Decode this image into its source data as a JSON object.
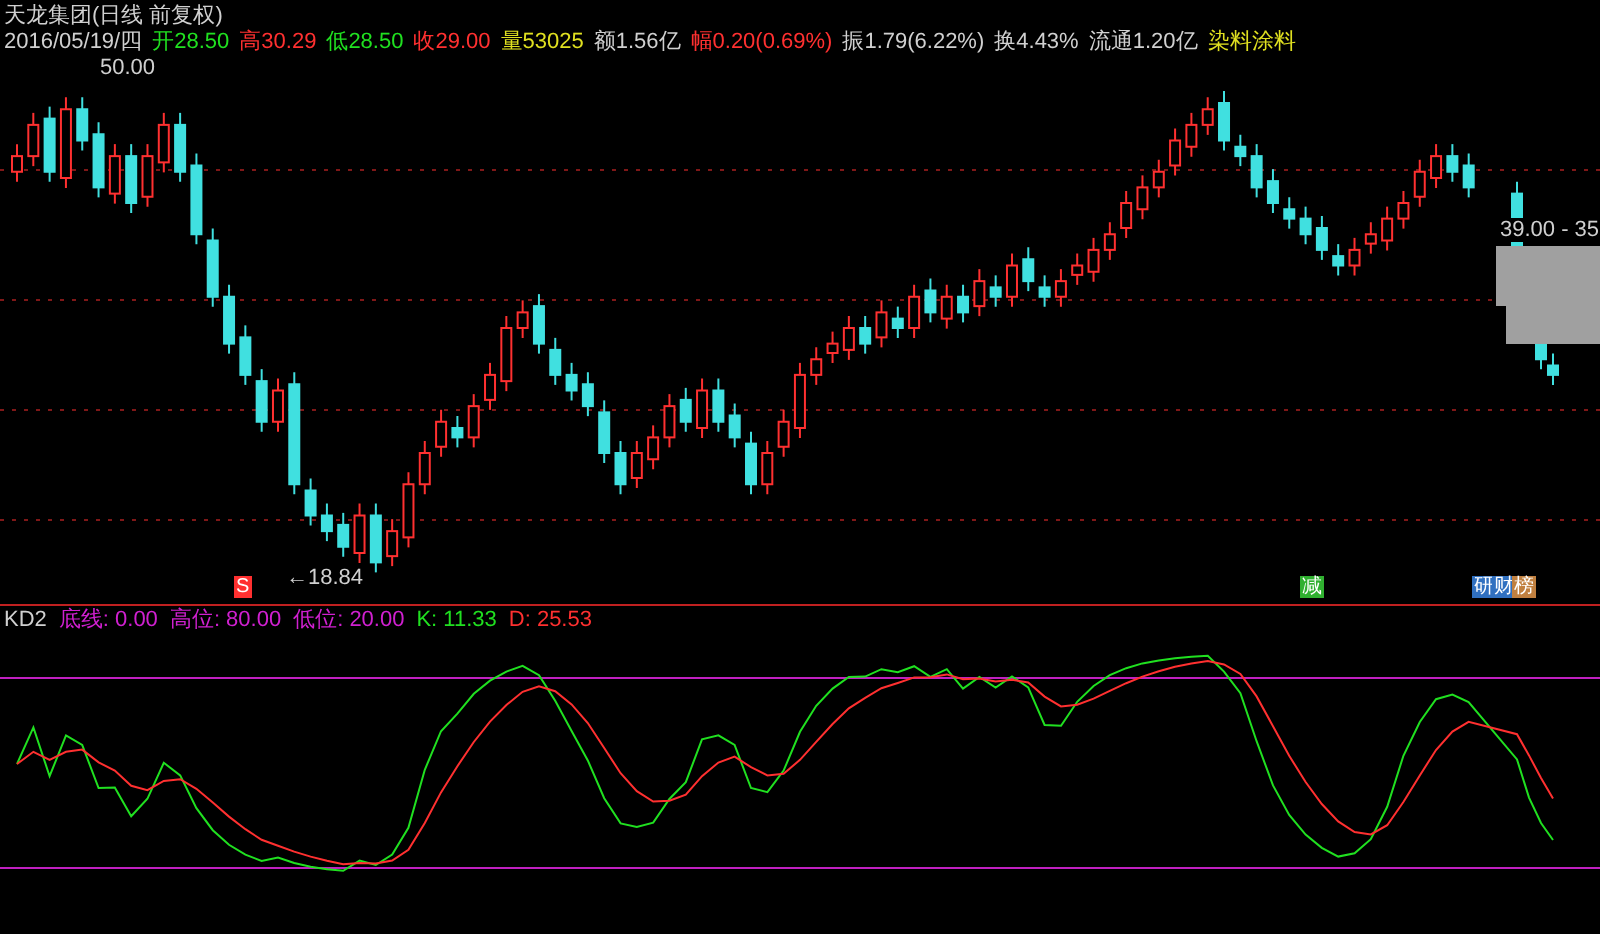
{
  "title": {
    "name": "天龙集团",
    "period": "(日线 前复权)"
  },
  "quote": {
    "date": "2016/05/19/四",
    "fields": [
      {
        "text": "开28.50",
        "color": "#20e020"
      },
      {
        "text": "高30.29",
        "color": "#ff3030"
      },
      {
        "text": "低28.50",
        "color": "#20e020"
      },
      {
        "text": "收29.00",
        "color": "#ff3030"
      },
      {
        "text": "量53025",
        "color": "#e0e020"
      },
      {
        "text": "额1.56亿",
        "color": "#d0d0d0"
      },
      {
        "text": "幅0.20(0.69%)",
        "color": "#ff3030"
      },
      {
        "text": "振1.79(6.22%)",
        "color": "#d0d0d0"
      },
      {
        "text": "换4.43%",
        "color": "#d0d0d0"
      },
      {
        "text": "流通1.20亿",
        "color": "#d0d0d0"
      },
      {
        "text": "染料涂料",
        "color": "#e0e020"
      }
    ]
  },
  "chart": {
    "high_label": "50.00",
    "low_label": "←18.84",
    "price_box_label": "39.00 - 35",
    "markers": [
      {
        "text": "S",
        "color": "#ff3030"
      },
      {
        "text": "减",
        "color": "#30b030"
      },
      {
        "text": "研",
        "color": "#3070c0"
      },
      {
        "text": "财",
        "color": "#3070c0"
      },
      {
        "text": "榜",
        "color": "#c08040"
      }
    ]
  },
  "indicator": {
    "name": "KD2",
    "params": [
      {
        "text": "底线: 0.00",
        "color": "#d020d0"
      },
      {
        "text": "高位: 80.00",
        "color": "#d020d0"
      },
      {
        "text": "低位: 20.00",
        "color": "#d020d0"
      },
      {
        "text": "K: 11.33",
        "color": "#20e020"
      },
      {
        "text": "D: 25.53",
        "color": "#ff3030"
      }
    ]
  }
}
